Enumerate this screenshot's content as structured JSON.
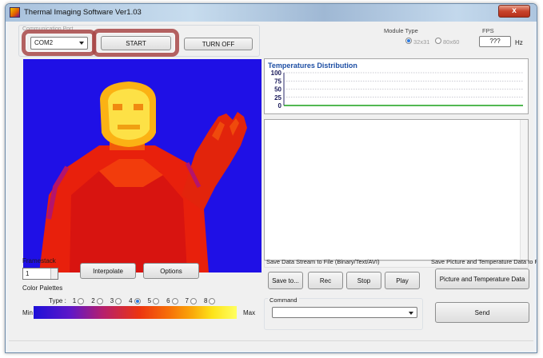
{
  "window": {
    "title": "Thermal Imaging Software   Ver1.03",
    "close_label": "x"
  },
  "connection": {
    "group_title": "Communication Port",
    "port_value": "COM2",
    "start_label": "START",
    "turnoff_label": "TURN OFF"
  },
  "module": {
    "group_title": "Module Type",
    "option1": "32x31",
    "option2": "80x60",
    "selected": "32x31"
  },
  "fps": {
    "group_title": "FPS",
    "value": "???",
    "unit": "Hz"
  },
  "chart_data": {
    "type": "line",
    "title": "Temperatures Distribution",
    "ylim": [
      0,
      100
    ],
    "yticks": [
      "100",
      "75",
      "50",
      "25",
      "0"
    ],
    "series": [
      {
        "values": [
          0,
          0,
          0,
          0,
          0,
          0,
          0,
          0,
          0,
          0
        ]
      }
    ],
    "grid": "dotted"
  },
  "framestack": {
    "label": "Framestack",
    "value": "1",
    "interpolate_label": "Interpolate",
    "options_label": "Options"
  },
  "palettes": {
    "label": "Color Palettes",
    "type_label": "Type :",
    "types": [
      "1",
      "2",
      "3",
      "4",
      "5",
      "6",
      "7",
      "8"
    ],
    "selected_type": "4",
    "min_label": "Min",
    "max_label": "Max"
  },
  "save_stream": {
    "group_title": "Save Data Stream to File (Binary/Text/AVI)",
    "save_to_label": "Save to...",
    "rec_label": "Rec",
    "stop_label": "Stop",
    "play_label": "Play"
  },
  "save_picture": {
    "group_title": "Save Picture and Temperature Data to File",
    "button_label": "Picture and Temperature Data"
  },
  "command": {
    "label": "Command",
    "value": "",
    "send_label": "Send"
  },
  "colors": {
    "thermal_background": "#1f10e6",
    "chart_title": "#1e4fa4",
    "chart_line": "#18a018",
    "highlight_ring": "#a84848"
  }
}
